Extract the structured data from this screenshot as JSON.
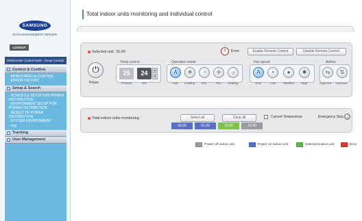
{
  "sidebar": {
    "brand": "SAMSUNG",
    "subtitle": "DATA MANAGEMENT SERVER",
    "logout_label": "LOGOUT",
    "mode_text": "DMS(Center Control Mode : Group Control)",
    "menu": [
      {
        "header": "Control & Confirm",
        "items": [
          "MONITORING & CONTROL",
          "ERROR HISTORY"
        ]
      },
      {
        "header": "Setup & Search",
        "items": [
          "SCHEDULE SETUP FOR POWER DISTRIBUTION",
          "ENVIRONMENT SETUP FOR POWER DISTRIBUTION",
          "RESULT OF POWER DISTRIBUTION",
          "SYSTEM ENVIRONMENT",
          "Log"
        ]
      },
      {
        "header": "Tracking",
        "items": []
      },
      {
        "header": "User Management",
        "items": []
      }
    ]
  },
  "main": {
    "title": "Total indoor units monitoring and individual control",
    "selected_unit_label": "Selected unit",
    "selected_unit_value": "15.00",
    "error_label": "Error",
    "enable_remote_label": "Enable Remote Control",
    "disable_remote_label": "Disable Remote Control",
    "power_label": "Power",
    "temp_control_label": "Temp.control",
    "temp_present_value": "25",
    "temp_set_value": "24",
    "present_label": "Present",
    "set_label": "Set",
    "operation_mode_label": "Operation mode",
    "operation_modes": [
      "Auto",
      "Cooling",
      "Dry",
      "Fan",
      "Heating"
    ],
    "fan_speed_label": "Fan speed",
    "fan_speeds": [
      "Auto",
      "Low",
      "Medium",
      "High"
    ],
    "airflow_label": "Airflow",
    "airflow_modes": [
      "Right/Left",
      "Up/Down"
    ],
    "total_monitoring_label": "Total indoor units monitoring",
    "select_all_label": "Select all",
    "clear_all_label": "Clear all",
    "current_temp_label": "Current Temperature",
    "emergency_stop_label": "Emergency Stop",
    "units": [
      {
        "id": "00.00",
        "color": "#5b6fc4"
      },
      {
        "id": "01.00",
        "color": "#5b6fc4"
      },
      {
        "id": "15.00",
        "color": "#7fc24a"
      },
      {
        "id": "15.00",
        "color": "#9a9c9f"
      }
    ],
    "legend": [
      {
        "label": "Power off indoor unit",
        "color": "#9a9c9f"
      },
      {
        "label": "Power on indoor unit",
        "color": "#4f6ed0"
      },
      {
        "label": "Selected indoor unit",
        "color": "#5bb84a"
      },
      {
        "label": "Error",
        "color": "#d93a2b"
      }
    ]
  },
  "icons": {
    "power": "power-icon",
    "error": "error-icon",
    "operation_modes": [
      "auto-mode-icon",
      "cooling-icon",
      "dry-icon",
      "fan-icon",
      "heating-icon"
    ],
    "fan_speeds": [
      "fan-auto-icon",
      "fan-low-icon",
      "fan-medium-icon",
      "fan-high-icon"
    ],
    "airflow": [
      "airflow-right-left-icon",
      "airflow-up-down-icon"
    ]
  }
}
